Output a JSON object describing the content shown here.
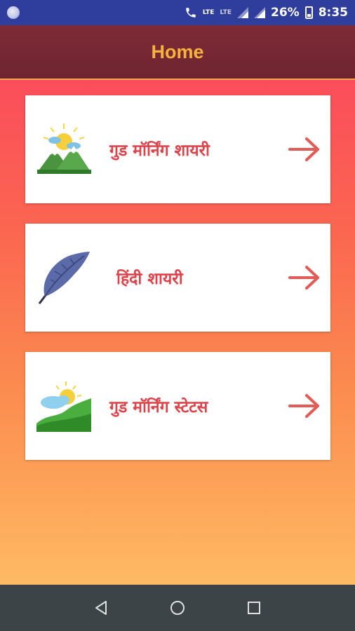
{
  "status_bar": {
    "network_type": "LTE",
    "secondary_network": "LTE",
    "battery_percent": "26%",
    "time": "8:35"
  },
  "toolbar": {
    "title": "Home"
  },
  "menu": {
    "items": [
      {
        "label": "गुड मॉर्निंग शायरी",
        "icon": "sunrise-mountain-icon"
      },
      {
        "label": "हिंदी शायरी",
        "icon": "feather-icon"
      },
      {
        "label": "गुड मॉर्निंग स्टेटस",
        "icon": "sun-cloud-hills-icon"
      }
    ]
  },
  "colors": {
    "status_bar": "#2f3d9d",
    "toolbar": "#7d2b36",
    "title": "#f6b23c",
    "label": "#e0424a",
    "nav_bar": "#3c4448"
  }
}
